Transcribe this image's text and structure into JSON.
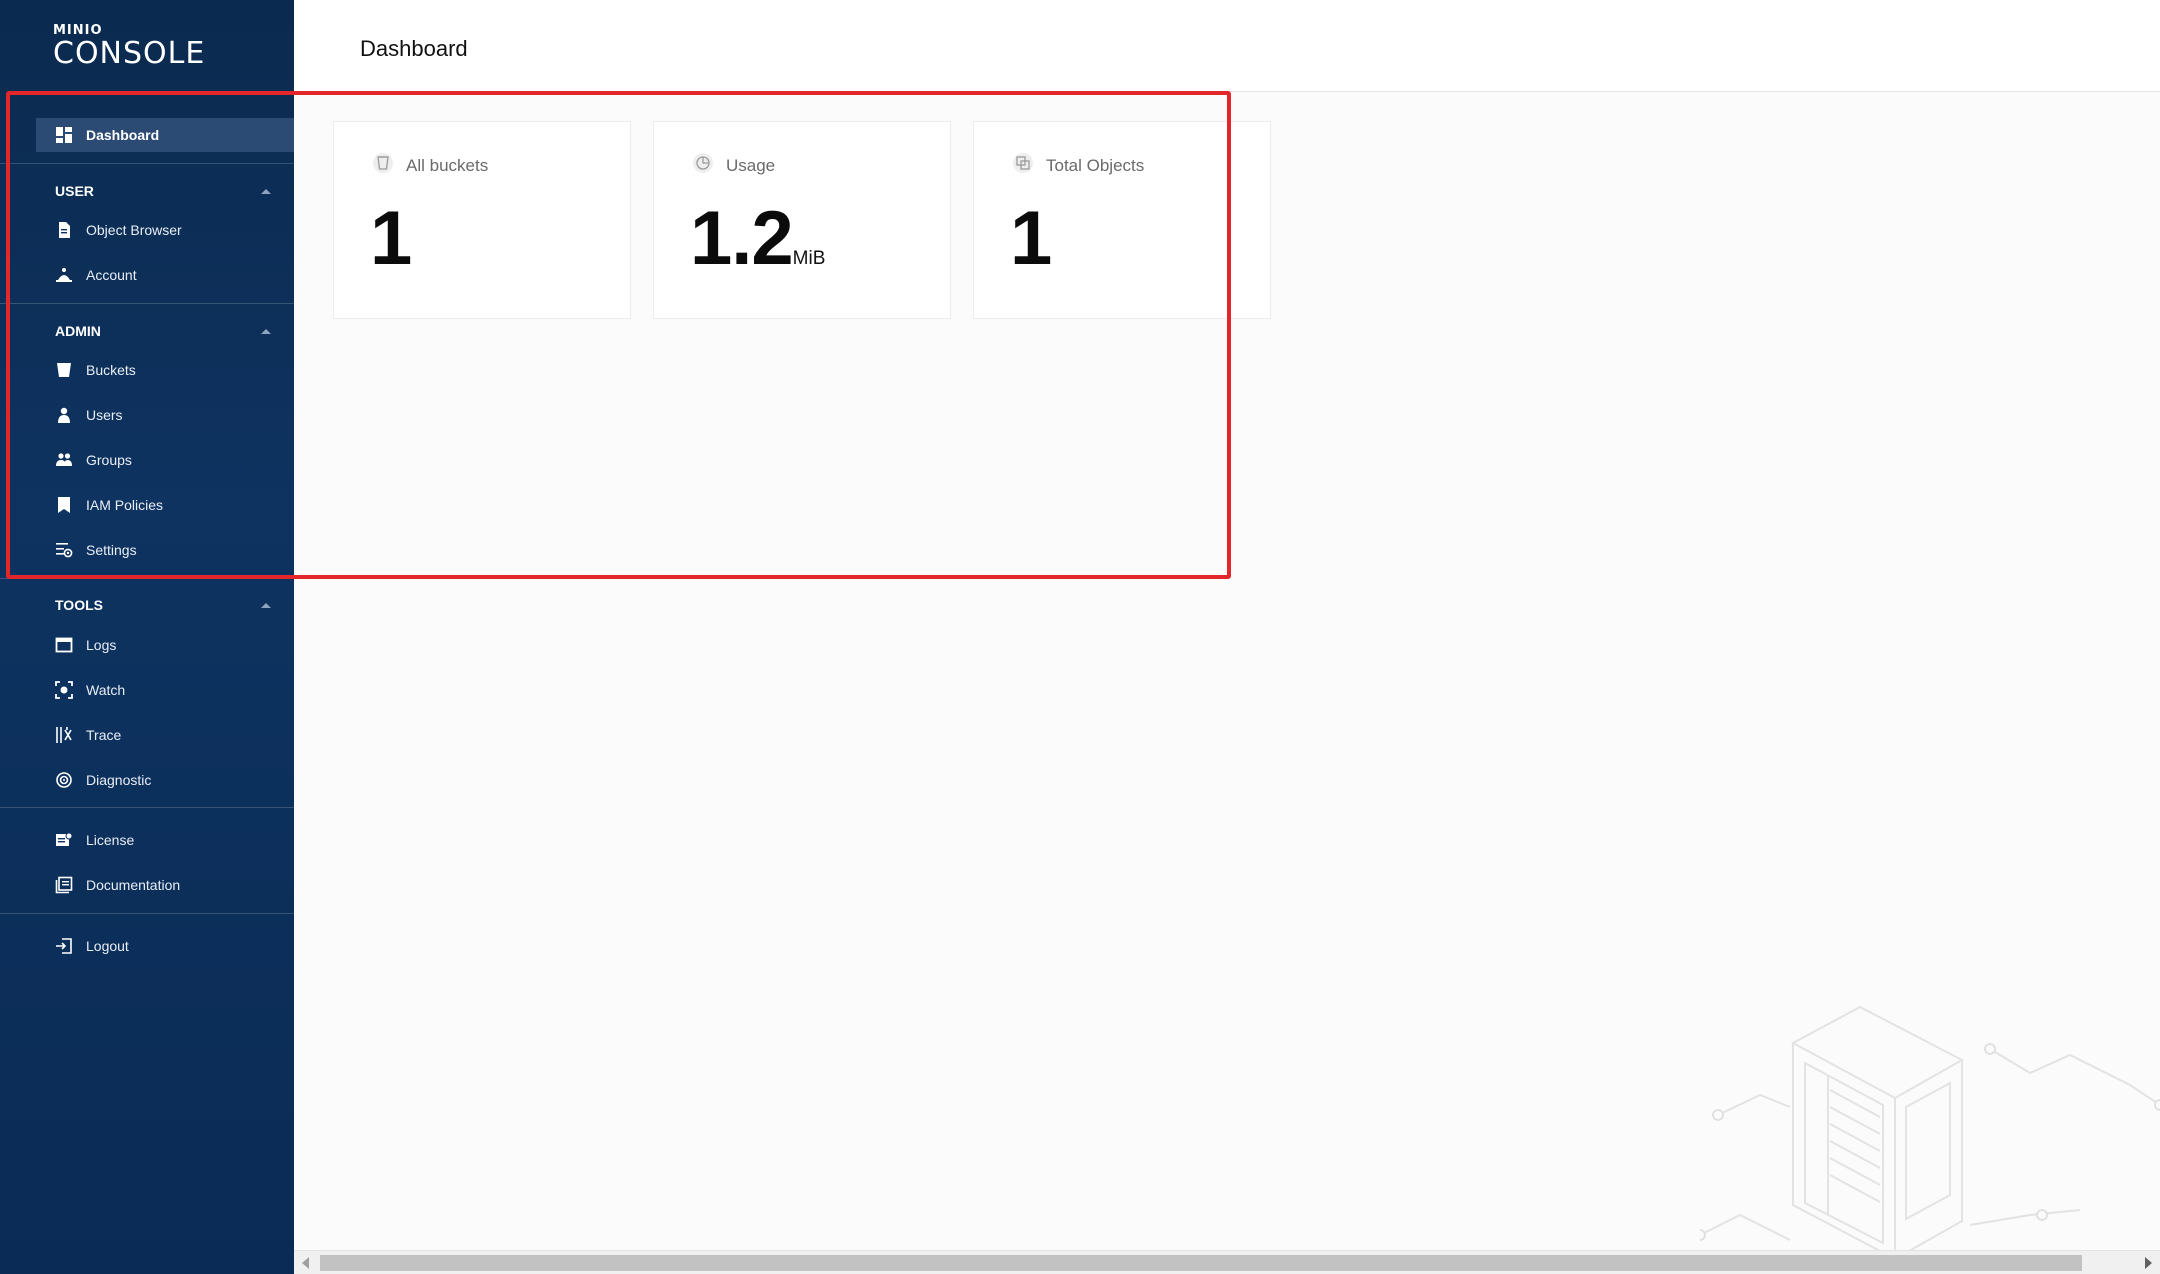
{
  "logo": {
    "brand": "MINIO",
    "product": "CONSOLE"
  },
  "sidebar": {
    "dashboard": "Dashboard",
    "user_section": "USER",
    "user_items": [
      "Object Browser",
      "Account"
    ],
    "admin_section": "ADMIN",
    "admin_items": [
      "Buckets",
      "Users",
      "Groups",
      "IAM Policies",
      "Settings"
    ],
    "tools_section": "TOOLS",
    "tools_items": [
      "Logs",
      "Watch",
      "Trace",
      "Diagnostic"
    ],
    "extra_items": [
      "License",
      "Documentation"
    ],
    "logout": "Logout"
  },
  "header": {
    "title": "Dashboard"
  },
  "cards": [
    {
      "label": "All buckets",
      "value": "1",
      "unit": ""
    },
    {
      "label": "Usage",
      "value": "1.2",
      "unit": "MiB"
    },
    {
      "label": "Total Objects",
      "value": "1",
      "unit": ""
    }
  ],
  "colors": {
    "sidebar_bg": "#0e3360",
    "active_item": "#2b4a74",
    "highlight": "#e3262a"
  }
}
